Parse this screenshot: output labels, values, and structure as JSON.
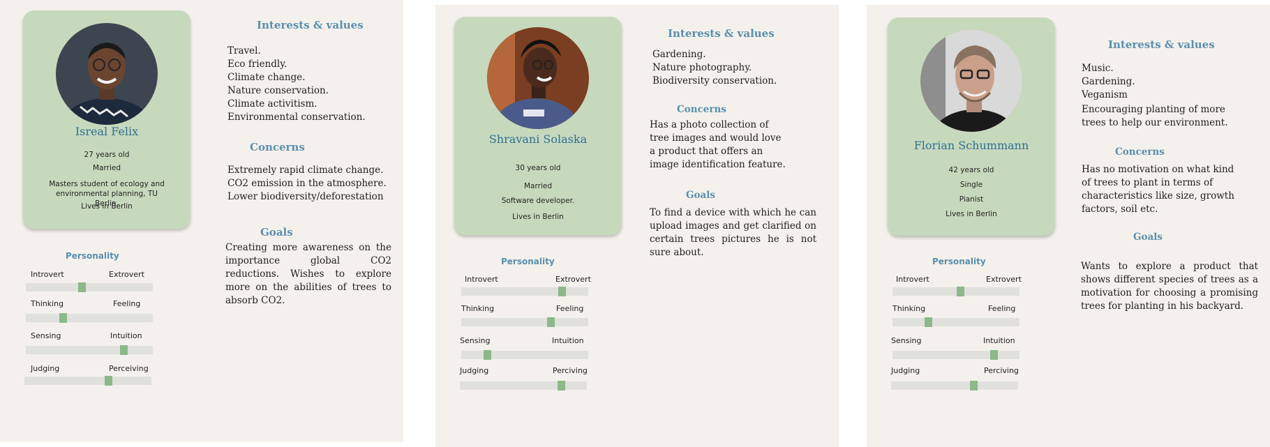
{
  "colors": {
    "panel_bg": "#f4f1ec",
    "card_bg": "#c7d9bd",
    "accent": "#5a8fae",
    "name_color": "#2e6f93",
    "slider_track": "#e0e0dc",
    "slider_thumb": "#8cb88a"
  },
  "personas": [
    {
      "name": "Isreal Felix",
      "details": [
        "27 years old",
        "Married",
        "Masters student of ecology and environmental planning, TU Berlin.",
        "Lives in Berlin"
      ],
      "interests_heading": "Interests & values",
      "interests": [
        "Travel.",
        "Eco friendly.",
        "Climate change.",
        "Nature conservation.",
        "Climate activitism.",
        "Environmental conservation."
      ],
      "concerns_heading": "Concerns",
      "concerns": [
        "Extremely rapid climate change.",
        "CO2 emission in the atmosphere.",
        "Lower biodiversity/deforestation"
      ],
      "goals_heading": "Goals",
      "goals": "Creating more awareness on the importance global CO2 reductions. Wishes to explore more on the abilities of trees to absorb CO2.",
      "personality_heading": "Personality",
      "traits": [
        {
          "left": "Introvert",
          "right": "Extrovert",
          "value": 0.44
        },
        {
          "left": "Thinking",
          "right": "Feeling",
          "value": 0.28
        },
        {
          "left": "Sensing",
          "right": "Intuition",
          "value": 0.79
        },
        {
          "left": "Judging",
          "right": "Perceiving",
          "value": 0.67
        }
      ]
    },
    {
      "name": "Shravani Solaska",
      "details": [
        "30 years old",
        "Married",
        "Software developer.",
        "Lives in Berlin"
      ],
      "interests_heading": "Interests & values",
      "interests": [
        "Gardening.",
        "Nature photography.",
        "Biodiversity conservation."
      ],
      "concerns_heading": "Concerns",
      "concerns": "Has a photo collection of tree images and would love a product that offers an image identification feature.",
      "goals_heading": "Goals",
      "goals": "To find a device with which he can upload images and get clarified on certain trees pictures he is not sure about.",
      "personality_heading": "Personality",
      "traits": [
        {
          "left": "Introvert",
          "right": "Extrovert",
          "value": 0.81
        },
        {
          "left": "Thinking",
          "right": "Feeling",
          "value": 0.72
        },
        {
          "left": "Sensing",
          "right": "Intuition",
          "value": 0.19
        },
        {
          "left": "Judging",
          "right": "Perciving",
          "value": 0.82
        }
      ]
    },
    {
      "name": "Florian Schummann",
      "details": [
        "42 years old",
        "Single",
        "Pianist",
        "Lives in Berlin"
      ],
      "interests_heading": "Interests & values",
      "interests": [
        "Music.",
        "Gardening.",
        "Veganism"
      ],
      "interests_extra": "Encouraging planting of more trees to help our environment.",
      "concerns_heading": "Concerns",
      "concerns": "Has no motivation on what kind of trees to plant in terms of characteristics like size, growth factors, soil etc.",
      "goals_heading": "Goals",
      "goals": "Wants to explore a product that shows different species of trees as a motivation for choosing a promising trees for planting in his backyard.",
      "personality_heading": "Personality",
      "traits": [
        {
          "left": "Introvert",
          "right": "Extrovert",
          "value": 0.54
        },
        {
          "left": "Thinking",
          "right": "Feeling",
          "value": 0.27
        },
        {
          "left": "Sensing",
          "right": "Intuition",
          "value": 0.82
        },
        {
          "left": "Judging",
          "right": "Perciving",
          "value": 0.66
        }
      ]
    }
  ]
}
